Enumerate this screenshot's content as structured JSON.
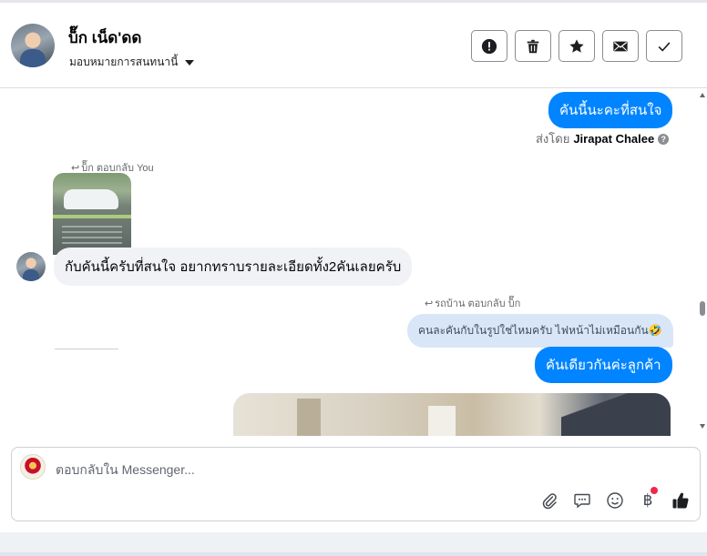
{
  "header": {
    "contact_name": "บ็๊ก เน็ด'ดด",
    "assign_label": "มอบหมายการสนทนานี้",
    "actions": [
      {
        "name": "report-button",
        "icon": "alert-circle-icon"
      },
      {
        "name": "delete-button",
        "icon": "trash-icon"
      },
      {
        "name": "star-button",
        "icon": "star-icon"
      },
      {
        "name": "mark-unread-button",
        "icon": "envelope-icon"
      },
      {
        "name": "mark-done-button",
        "icon": "checkmark-icon"
      }
    ]
  },
  "conversation": {
    "msg_outgoing_1": "คันนี้นะคะที่สนใจ",
    "sent_by_prefix": "ส่งโดย",
    "sent_by_name": "Jirapat Chalee",
    "reply_label_1": "บ็๊ก ตอบกลับ You",
    "msg_incoming_1": "กับคันนี้ครับที่สนใจ อยากทราบรายละเอียดทั้ง2คันเลยครับ",
    "reply_label_2": "รถบ้าน ตอบกลับ บ็๊ก",
    "reply_quote_2": "คนละคันกับในรูปใช่ไหมครับ ไฟหน้าไม่เหมือนกัน🤣",
    "msg_outgoing_2": "คันเดียวกันค่ะลูกค้า"
  },
  "composer": {
    "placeholder": "ตอบกลับใน Messenger...",
    "tools": [
      "paperclip-icon",
      "speech-bubble-icon",
      "emoji-icon",
      "baht-icon",
      "thumbs-up-icon"
    ],
    "baht_symbol": "฿"
  },
  "colors": {
    "outgoing_bubble": "#0084ff",
    "incoming_bubble": "#f0f2f5",
    "quote_bubble": "#d8e6f7",
    "notification_dot": "#f02849"
  }
}
